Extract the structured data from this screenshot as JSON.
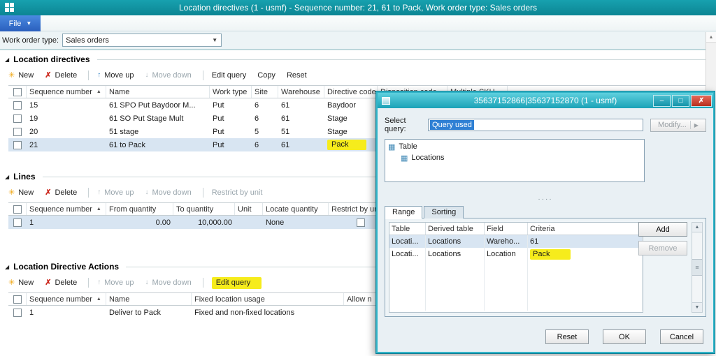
{
  "colors": {
    "accent_teal": "#12939f",
    "file_button_blue": "#2a5fbd",
    "highlight_yellow": "#f6ec1c",
    "selection_blue": "#d8e5f2",
    "close_button_red": "#c0392b"
  },
  "titlebar": {
    "title": "Location directives (1 - usmf) - Sequence number: 21, 61 to Pack, Work order type: Sales orders"
  },
  "file_menu": {
    "label": "File"
  },
  "filter_bar": {
    "work_order_type_label": "Work order type:",
    "work_order_type_value": "Sales orders"
  },
  "location_directives": {
    "title": "Location directives",
    "toolbar": {
      "new": "New",
      "delete": "Delete",
      "move_up": "Move up",
      "move_down": "Move down",
      "edit_query": "Edit query",
      "copy": "Copy",
      "reset": "Reset"
    },
    "columns": {
      "sequence": "Sequence number",
      "name": "Name",
      "work_type": "Work type",
      "site": "Site",
      "warehouse": "Warehouse",
      "directive_code": "Directive code",
      "disposition_code": "Disposition code",
      "multiple_sku": "Multiple SKU"
    },
    "rows": [
      {
        "sequence": "15",
        "name": "61 SPO Put Baydoor M...",
        "work_type": "Put",
        "site": "6",
        "warehouse": "61",
        "directive_code": "Baydoor"
      },
      {
        "sequence": "19",
        "name": "61 SO Put Stage Mult",
        "work_type": "Put",
        "site": "6",
        "warehouse": "61",
        "directive_code": "Stage"
      },
      {
        "sequence": "20",
        "name": "51 stage",
        "work_type": "Put",
        "site": "5",
        "warehouse": "51",
        "directive_code": "Stage"
      },
      {
        "sequence": "21",
        "name": "61 to Pack",
        "work_type": "Put",
        "site": "6",
        "warehouse": "61",
        "directive_code": "Pack"
      }
    ]
  },
  "lines": {
    "title": "Lines",
    "toolbar": {
      "new": "New",
      "delete": "Delete",
      "move_up": "Move up",
      "move_down": "Move down",
      "restrict_by_unit": "Restrict by unit"
    },
    "columns": {
      "sequence": "Sequence number",
      "from_quantity": "From quantity",
      "to_quantity": "To quantity",
      "unit": "Unit",
      "locate_quantity": "Locate quantity",
      "restrict_by_unit": "Restrict by unit"
    },
    "rows": [
      {
        "sequence": "1",
        "from_quantity": "0.00",
        "to_quantity": "10,000.00",
        "unit": "",
        "locate_quantity": "None"
      }
    ]
  },
  "location_directive_actions": {
    "title": "Location Directive Actions",
    "toolbar": {
      "new": "New",
      "delete": "Delete",
      "move_up": "Move up",
      "move_down": "Move down",
      "edit_query": "Edit query"
    },
    "columns": {
      "sequence": "Sequence number",
      "name": "Name",
      "fixed_location_usage": "Fixed location usage",
      "allow": "Allow n"
    },
    "rows": [
      {
        "sequence": "1",
        "name": "Deliver to Pack",
        "fixed_location_usage": "Fixed and non-fixed locations"
      }
    ]
  },
  "dialog": {
    "title": "35637152866|35637152870 (1 - usmf)",
    "select_query_label": "Select query:",
    "select_query_value": "Query used",
    "modify_button": "Modify...",
    "tree": {
      "root": "Table",
      "child": "Locations"
    },
    "tabs": {
      "range": "Range",
      "sorting": "Sorting"
    },
    "grid": {
      "columns": {
        "table": "Table",
        "derived_table": "Derived table",
        "field": "Field",
        "criteria": "Criteria"
      },
      "rows": [
        {
          "table": "Locati...",
          "derived_table": "Locations",
          "field": "Wareho...",
          "criteria": "61"
        },
        {
          "table": "Locati...",
          "derived_table": "Locations",
          "field": "Location",
          "criteria": "Pack"
        }
      ]
    },
    "buttons": {
      "add": "Add",
      "remove": "Remove",
      "reset": "Reset",
      "ok": "OK",
      "cancel": "Cancel"
    }
  }
}
